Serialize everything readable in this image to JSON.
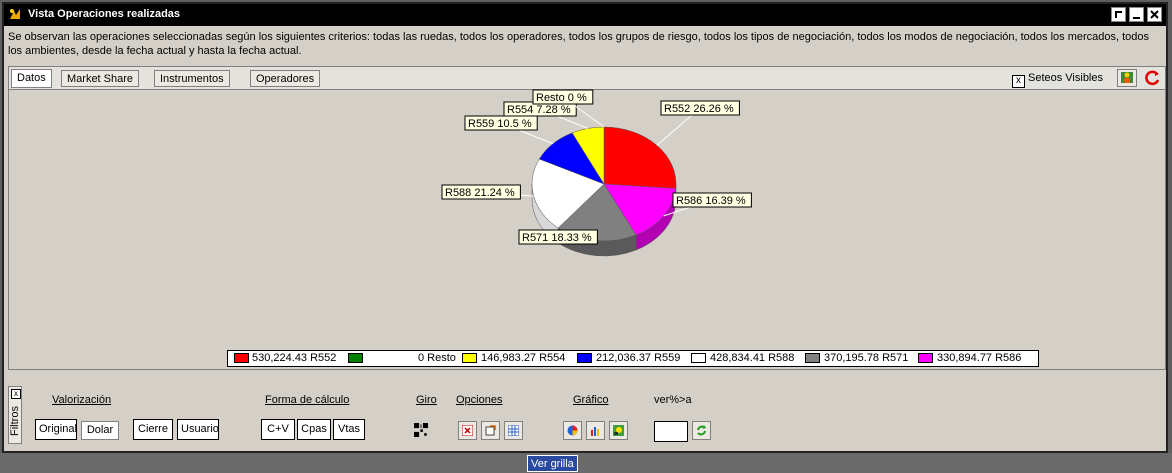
{
  "window": {
    "title": "Vista Operaciones realizadas",
    "description": "Se observan las operaciones seleccionadas según los siguientes criterios:  todas las ruedas, todos los operadores, todos los grupos de riesgo, todos los tipos de negociación, todos los modos de negociación, todos los mercados, todos los ambientes, desde la fecha actual y  hasta la fecha actual."
  },
  "tabs": [
    {
      "label": "Datos",
      "active": true
    },
    {
      "label": "Market Share",
      "active": false
    },
    {
      "label": "Instrumentos",
      "active": false
    },
    {
      "label": "Operadores",
      "active": false
    }
  ],
  "toolbar": {
    "seteos_label": "Seteos Visibles",
    "seteos_checked": true
  },
  "chart_data": {
    "type": "pie",
    "title": "",
    "slices": [
      {
        "name": "R552",
        "value": 530224.43,
        "percent": 26.26,
        "label": "R552 26.26 %",
        "color": "#ff0000"
      },
      {
        "name": "R586",
        "value": 330894.77,
        "percent": 16.39,
        "label": "R586 16.39 %",
        "color": "#ff00ff"
      },
      {
        "name": "R571",
        "value": 370195.78,
        "percent": 18.33,
        "label": "R571 18.33 %",
        "color": "#808080"
      },
      {
        "name": "R588",
        "value": 428834.41,
        "percent": 21.24,
        "label": "R588 21.24 %",
        "color": "#ffffff"
      },
      {
        "name": "R559",
        "value": 212036.37,
        "percent": 10.5,
        "label": "R559 10.5 %",
        "color": "#0000ff"
      },
      {
        "name": "R554",
        "value": 146983.27,
        "percent": 7.28,
        "label": "R554 7.28 %",
        "color": "#ffff00"
      },
      {
        "name": "Resto",
        "value": 0,
        "percent": 0,
        "label": "Resto 0 %",
        "color": "#008000"
      }
    ],
    "legend": [
      {
        "text": "530,224.43 R552",
        "color": "#ff0000"
      },
      {
        "text": "0 Resto",
        "color": "#008000"
      },
      {
        "text": "146,983.27 R554",
        "color": "#ffff00"
      },
      {
        "text": "212,036.37 R559",
        "color": "#0000ff"
      },
      {
        "text": "428,834.41 R588",
        "color": "#ffffff"
      },
      {
        "text": "370,195.78 R571",
        "color": "#808080"
      },
      {
        "text": "330,894.77 R586",
        "color": "#ff00ff"
      }
    ],
    "legend_position": "bottom",
    "style": "3d"
  },
  "filters": {
    "vertical_label": "Filtros",
    "valorizacion": {
      "label": "Valorización",
      "buttons": [
        "Original",
        "Dolar",
        "Cierre",
        "Usuario"
      ]
    },
    "forma_calculo": {
      "label": "Forma de cálculo",
      "buttons": [
        "C+V",
        "Cpas",
        "Vtas"
      ]
    },
    "giro": {
      "label": "Giro"
    },
    "opciones": {
      "label": "Opciones"
    },
    "grafico": {
      "label": "Gráfico"
    },
    "ver": {
      "label": "ver%>a",
      "value": ""
    }
  },
  "status": {
    "ver_grilla": "Ver grilla"
  }
}
